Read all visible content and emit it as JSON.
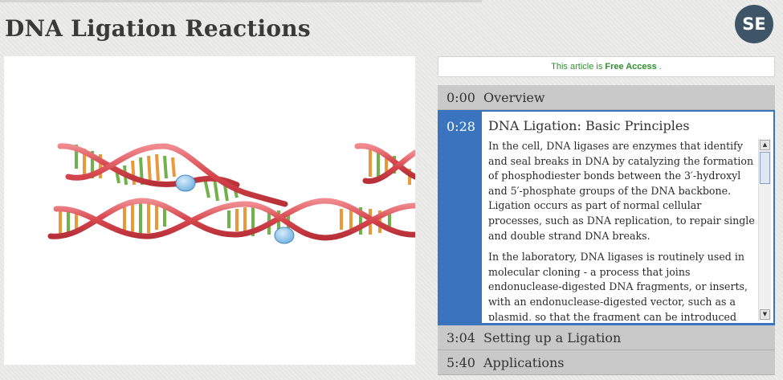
{
  "page": {
    "title": "DNA Ligation Reactions",
    "logo_text": "SE"
  },
  "access": {
    "prefix": "This article is",
    "highlight": "Free Access",
    "suffix": "."
  },
  "chapters": [
    {
      "time": "0:00",
      "label": "Overview"
    },
    {
      "time": "0:28",
      "label": "DNA Ligation: Basic Principles",
      "active": true
    },
    {
      "time": "3:04",
      "label": "Setting up a Ligation"
    },
    {
      "time": "5:40",
      "label": "Applications"
    }
  ],
  "active_chapter": {
    "paragraphs": [
      "In the cell, DNA ligases are enzymes that identify and seal breaks in DNA by catalyzing the formation of phosphodiester bonds between the 3′-hydroxyl and 5′-phosphate groups of the DNA backbone. Ligation occurs as part of normal cellular processes, such as DNA replication, to repair single and double strand DNA breaks.",
      "In the laboratory, DNA ligases is routinely used in molecular cloning - a process that joins endonuclease-digested DNA fragments, or inserts, with an endonuclease-digested vector, such as a plasmid, so that the fragment can be introduced"
    ]
  },
  "colors": {
    "accent": "#3a74bf",
    "logo_bg": "#3d5566",
    "free_access": "#2f8f2f",
    "strand": "#d6454c",
    "base_green": "#6fb24a",
    "base_orange": "#e89a3a",
    "ligase": "#8ec6ea"
  },
  "icons": {
    "scroll_up": "triangle-up-icon",
    "scroll_down": "triangle-down-icon"
  }
}
